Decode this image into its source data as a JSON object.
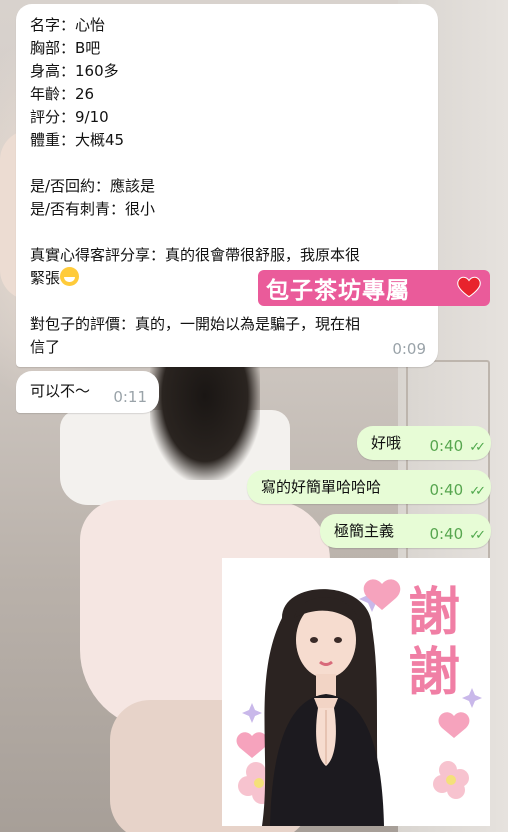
{
  "chat": {
    "incoming_profile": {
      "lines": [
        "名字：心怡",
        "胸部：B吧",
        "身高：160多",
        "年齡：26",
        "評分：9/10",
        "體重：大概45",
        "",
        "是/否回約：應該是",
        "是/否有刺青：很小",
        "",
        "真實心得客評分享：真的很會帶很舒服，我原本很",
        "緊張",
        "",
        "對包子的評價：真的，一開始以為是騙子，現在相",
        "信了"
      ],
      "time": "0:09",
      "emoji": "grinning-sweat-emoji"
    },
    "incoming_reply": {
      "text": "可以不〜",
      "time": "0:11"
    },
    "outgoing": [
      {
        "text": "好哦",
        "time": "0:40"
      },
      {
        "text": "寫的好簡單哈哈哈",
        "time": "0:40"
      },
      {
        "text": "極簡主義",
        "time": "0:40"
      }
    ],
    "promo_label": "包子茶坊專屬",
    "sticker": {
      "caption": "謝謝"
    }
  },
  "colors": {
    "incoming_bubble": "#ffffff",
    "outgoing_bubble": "#e7fcd6",
    "read_ticks": "#4fa84c",
    "promo_bg": "#ea5b9a",
    "sticker_text": "#f07fa5"
  }
}
